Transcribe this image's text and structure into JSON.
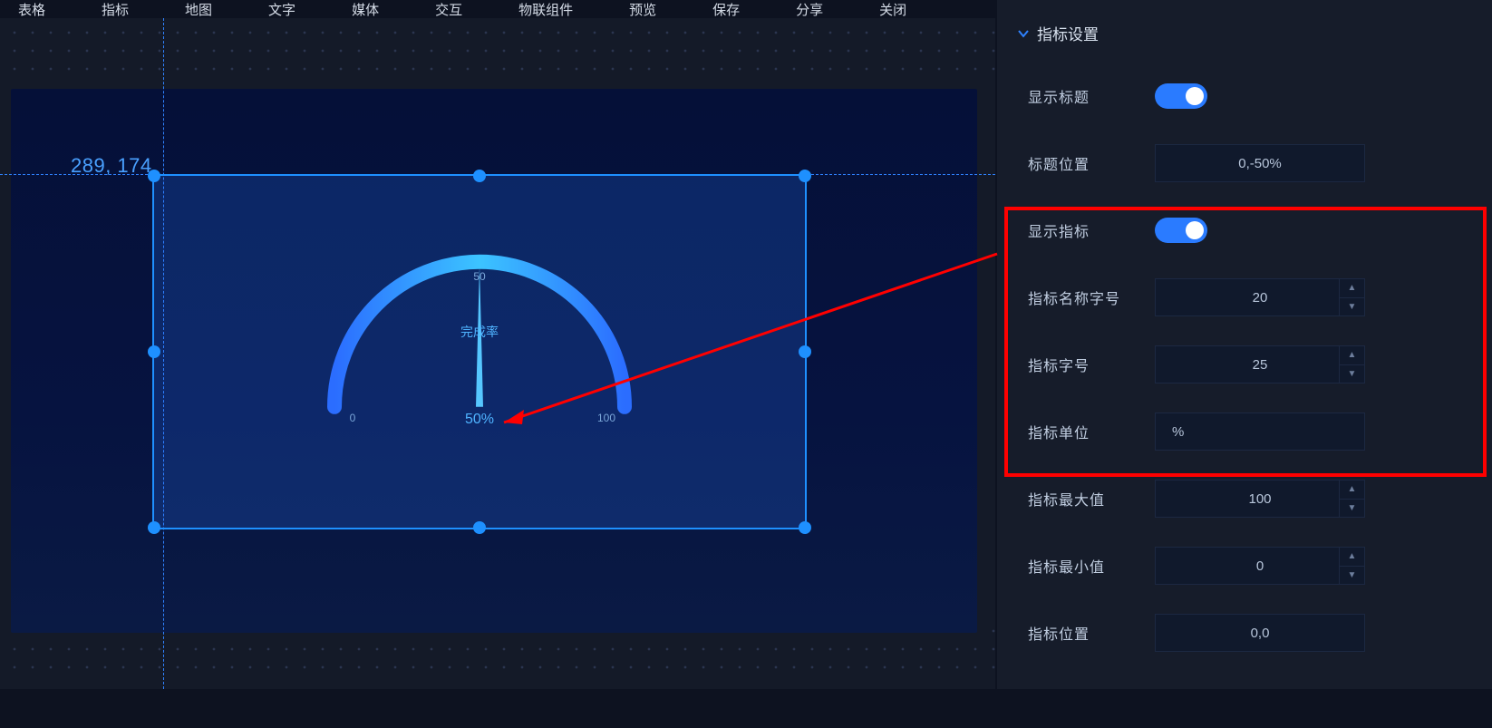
{
  "menu": [
    "表格",
    "指标",
    "地图",
    "文字",
    "媒体",
    "交互",
    "物联组件",
    "预览",
    "保存",
    "分享",
    "关闭"
  ],
  "editor": {
    "coord_label": "289, 174",
    "gauge": {
      "title": "完成率",
      "value_text": "50%",
      "tick_min": "0",
      "tick_mid": "50",
      "tick_max": "100"
    }
  },
  "panel": {
    "header": "指标设置",
    "show_title_label": "显示标题",
    "title_pos_label": "标题位置",
    "title_pos_value": "0,-50%",
    "show_indicator_label": "显示指标",
    "name_size_label": "指标名称字号",
    "name_size_value": "20",
    "ind_size_label": "指标字号",
    "ind_size_value": "25",
    "unit_label": "指标单位",
    "unit_value": "%",
    "max_label": "指标最大值",
    "max_value": "100",
    "min_label": "指标最小值",
    "min_value": "0",
    "pos_label": "指标位置",
    "pos_value": "0,0"
  },
  "chart_data": {
    "type": "gauge",
    "title": "完成率",
    "value": 50,
    "min": 0,
    "max": 100,
    "unit": "%",
    "ticks": [
      0,
      50,
      100
    ]
  }
}
